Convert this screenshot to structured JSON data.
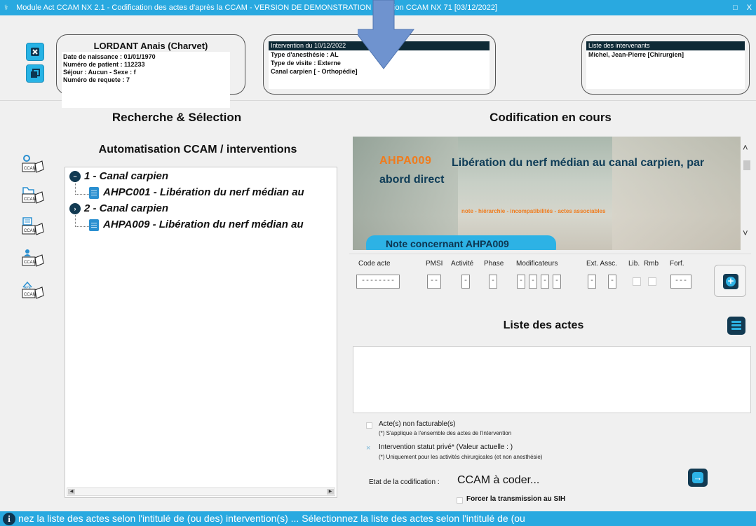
{
  "window": {
    "title": "Module Act CCAM NX 2.1 - Codification des actes d'après la CCAM - VERSION DE DEMONSTRATION - Version CCAM NX 71 [03/12/2022]",
    "controls": [
      "□",
      "X"
    ]
  },
  "patient": {
    "name": "LORDANT Anais (Charvet)",
    "lines": [
      "Date de naissance : 01/01/1970",
      "Numéro de patient : 112233",
      "Séjour : Aucun - Sexe : f",
      "Numéro de requete : 7"
    ]
  },
  "intervention": {
    "header": "Intervention du 10/12/2022",
    "lines": [
      "Type d'anesthésie : AL",
      "Type de visite : Externe",
      "Canal carpien [ - Orthopédie]"
    ]
  },
  "intervenants": {
    "header": "Liste des intervenants",
    "lines": [
      "Michel, Jean-Pierre [Chirurgien]"
    ]
  },
  "left": {
    "title": "Recherche & Sélection",
    "subtitle": "Automatisation CCAM / interventions",
    "tools": [
      "search-ccam-icon",
      "folder-ccam-icon",
      "list-ccam-icon",
      "user-ccam-icon",
      "ape-ccam-icon"
    ],
    "tree": [
      {
        "group": "1 - Canal carpien",
        "act": "AHPC001 - Libération du nerf médian au"
      },
      {
        "group": "2 - Canal carpien",
        "act": "AHPA009 - Libération du nerf médian au"
      }
    ]
  },
  "right": {
    "title": "Codification en cours",
    "preview": {
      "code": "AHPA009",
      "label": "Libération du nerf médian au canal carpien, par abord direct",
      "links": "note - hiérarchie - incompatibilités - actes associables",
      "note_button": "Note concernant AHPA009"
    },
    "entry": {
      "labels": [
        "Code acte",
        "PMSI",
        "Activité",
        "Phase",
        "Modificateurs",
        "Ext. Assc.",
        "Lib.",
        "Rmb",
        "Forf."
      ],
      "code_value": "--------",
      "pmsi_value": "--",
      "activite_value": "-",
      "phase_value": "-",
      "modificateurs": [
        "-",
        "-",
        "-",
        "-"
      ],
      "ext_value": "-",
      "assc_value": "-",
      "forf_value": "---"
    },
    "list_title": "Liste des actes",
    "options": {
      "non_facturable": "Acte(s) non facturable(s)",
      "non_facturable_note": "(*) S'applique à l'ensemble des actes de l'intervention",
      "prive_mark": "×",
      "prive": "Intervention statut privé* (Valeur actuelle :  )",
      "prive_note": "(*) Uniquement pour les activités chirurgicales (et non anesthésie)"
    },
    "etat_label": "Etat de la codification :",
    "etat_value": "CCAM à coder...",
    "force_label": "Forcer la transmission au SIH"
  },
  "statusbar": {
    "text": "nez la liste des actes selon l'intitulé de (ou des) intervention(s) ...    Sélectionnez la liste des actes selon l'intitulé de (ou"
  },
  "colors": {
    "titlebar": "#29a9e0",
    "accent": "#2db2e5",
    "dark": "#123a52",
    "orange": "#f07b1c",
    "overlay_arrow": "#6f93cf"
  }
}
